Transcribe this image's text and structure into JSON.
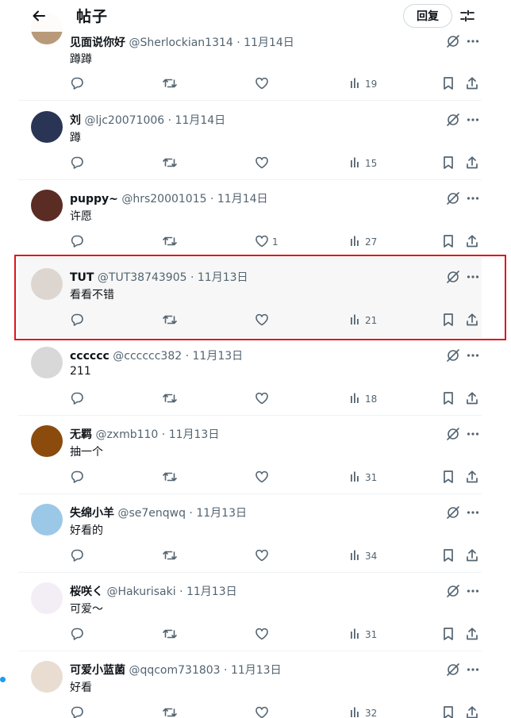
{
  "header": {
    "title": "帖子",
    "reply_label": "回复"
  },
  "posts": [
    {
      "name": "见面说你好",
      "handle": "@Sherlockian1314",
      "date": "11月14日",
      "text": "蹲蹲",
      "likes": "",
      "views": "19",
      "avatar_color": "#b89a7a"
    },
    {
      "name": "刘",
      "handle": "@ljc20071006",
      "date": "11月14日",
      "text": "蹲",
      "likes": "",
      "views": "15",
      "avatar_color": "#2a3556"
    },
    {
      "name": "puppy~",
      "handle": "@hrs20001015",
      "date": "11月14日",
      "text": "许愿",
      "likes": "1",
      "views": "27",
      "avatar_color": "#5a2c24"
    },
    {
      "name": "TUT",
      "handle": "@TUT38743905",
      "date": "11月13日",
      "text": "看看不错",
      "likes": "",
      "views": "21",
      "avatar_color": "#ddd6d0"
    },
    {
      "name": "cccccc",
      "handle": "@cccccc382",
      "date": "11月13日",
      "text": "211",
      "likes": "",
      "views": "18",
      "avatar_color": "#d8d8d8"
    },
    {
      "name": "无羁",
      "handle": "@zxmb110",
      "date": "11月13日",
      "text": "抽一个",
      "likes": "",
      "views": "31",
      "avatar_color": "#8a4b0c"
    },
    {
      "name": "失绵小羊",
      "handle": "@se7enqwq",
      "date": "11月13日",
      "text": "好看的",
      "likes": "",
      "views": "34",
      "avatar_color": "#9cc8e8"
    },
    {
      "name": "桜咲く",
      "handle": "@Hakurisaki",
      "date": "11月13日",
      "text": "可爱～",
      "likes": "",
      "views": "31",
      "avatar_color": "#f3eef5"
    },
    {
      "name": "可爱小蓝菌",
      "handle": "@qqcom731803",
      "date": "11月13日",
      "text": "好看",
      "likes": "",
      "views": "32",
      "avatar_color": "#e9ddd2"
    }
  ]
}
